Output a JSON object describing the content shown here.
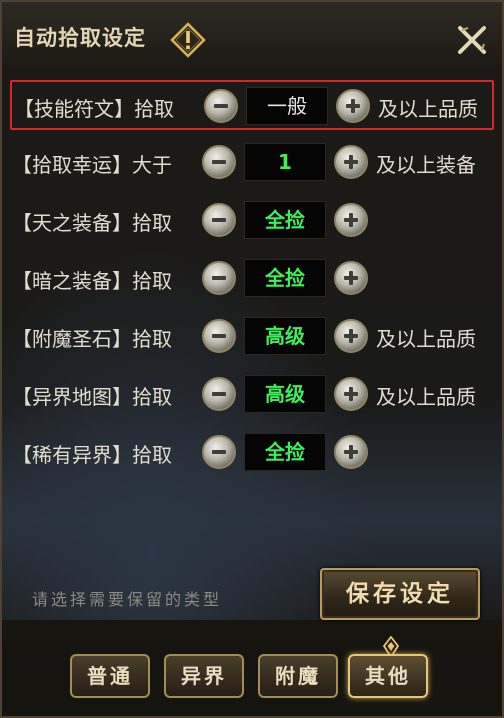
{
  "window": {
    "title": "自动拾取设定",
    "warn_icon": "exclamation-diamond-icon",
    "close_icon": "close-x-icon"
  },
  "rows": [
    {
      "name": "【技能符文】拾取",
      "value": "一般",
      "value_color": "#e8e6df",
      "suffix": "及以上品质",
      "highlighted": true
    },
    {
      "name": "【拾取幸运】大于",
      "value": "1",
      "value_color": "#3cf05a",
      "suffix": "及以上装备",
      "highlighted": false
    },
    {
      "name": "【天之装备】拾取",
      "value": "全捡",
      "value_color": "#3cf05a",
      "suffix": "",
      "highlighted": false
    },
    {
      "name": "【暗之装备】拾取",
      "value": "全捡",
      "value_color": "#3cf05a",
      "suffix": "",
      "highlighted": false
    },
    {
      "name": "【附魔圣石】拾取",
      "value": "高级",
      "value_color": "#3cf05a",
      "suffix": "及以上品质",
      "highlighted": false
    },
    {
      "name": "【异界地图】拾取",
      "value": "高级",
      "value_color": "#3cf05a",
      "suffix": "及以上品质",
      "highlighted": false
    },
    {
      "name": "【稀有异界】拾取",
      "value": "全捡",
      "value_color": "#3cf05a",
      "suffix": "",
      "highlighted": false
    }
  ],
  "footer": {
    "hint": "请选择需要保留的类型",
    "save_label": "保存设定"
  },
  "tabs": [
    {
      "label": "普通",
      "active": false
    },
    {
      "label": "异界",
      "active": false
    },
    {
      "label": "附魔",
      "active": false
    },
    {
      "label": "其他",
      "active": true
    }
  ],
  "colors": {
    "highlight_border": "#d7262b",
    "value_green": "#3cf05a",
    "gold_border": "#b59c5e"
  }
}
